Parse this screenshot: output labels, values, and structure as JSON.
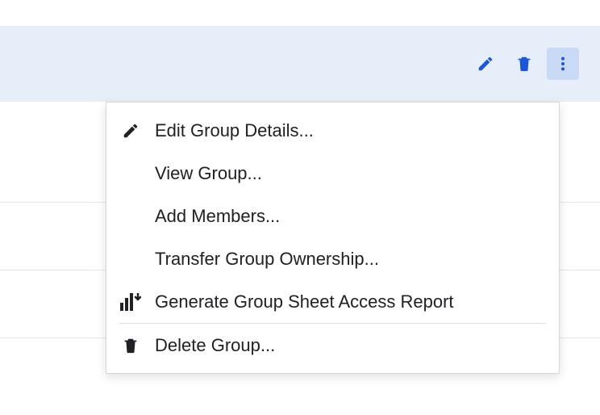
{
  "colors": {
    "accent": "#1a56db",
    "headerBg": "#e6eefa",
    "moreBg": "#c9daf7",
    "text": "#202124"
  },
  "toolbar": {
    "editTooltip": "Edit",
    "deleteTooltip": "Delete",
    "moreTooltip": "More options"
  },
  "menu": {
    "editGroupDetails": "Edit Group Details...",
    "viewGroup": "View Group...",
    "addMembers": "Add Members...",
    "transferOwnership": "Transfer Group Ownership...",
    "generateReport": "Generate Group Sheet Access Report",
    "deleteGroup": "Delete Group..."
  }
}
